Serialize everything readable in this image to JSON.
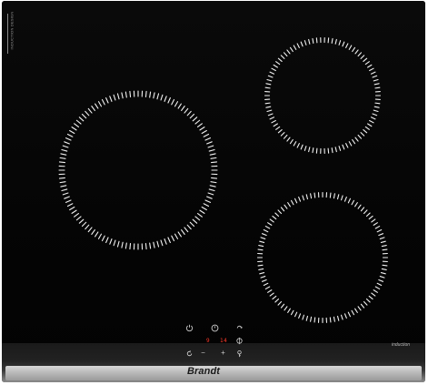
{
  "product": {
    "brand": "Brandt",
    "label": "induction",
    "side_label": "INDUCTION DESIGN"
  },
  "controls": {
    "display_left": "9",
    "display_right": "14",
    "plus": "+",
    "minus": "−"
  },
  "colors": {
    "glass": "#040404",
    "dashes": "#ffffff",
    "display": "#ff3a2a",
    "steel": "#bdbdbd"
  },
  "icons": [
    "power-icon",
    "timer-icon",
    "lock-icon",
    "zone-select-icon",
    "pause-icon",
    "key-icon"
  ]
}
